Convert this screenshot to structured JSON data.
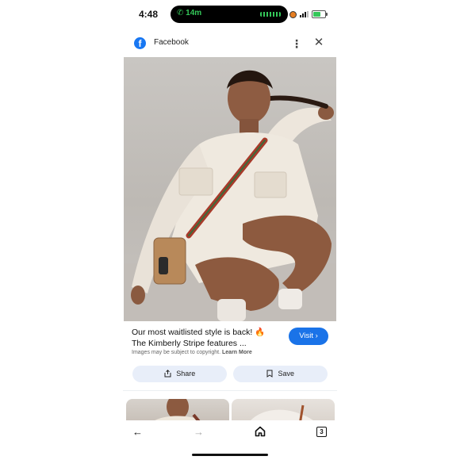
{
  "status_bar": {
    "time": "4:48",
    "call_duration": "14m"
  },
  "header": {
    "app_name": "Facebook",
    "logo_letter": "f",
    "more_glyph": "⋮",
    "close_glyph": "✕"
  },
  "post": {
    "caption_line1": "Our most waitlisted style is back! 🔥",
    "caption_line2": "The Kimberly Stripe features ...",
    "copyright_note": "Images may be subject to copyright.",
    "learn_more": "Learn More",
    "visit_label": "Visit ›"
  },
  "actions": {
    "share_label": "Share",
    "save_label": "Save"
  },
  "bottom_nav": {
    "back_glyph": "←",
    "forward_glyph": "→",
    "tab_count": "3"
  },
  "icons": {
    "logo": "facebook-logo-icon",
    "more": "more-vertical-icon",
    "close": "close-icon",
    "share": "share-icon",
    "save": "bookmark-icon",
    "back": "arrow-left-icon",
    "forward": "arrow-right-icon",
    "home": "home-icon",
    "tabs": "tabs-icon"
  },
  "colors": {
    "accent": "#1a73e8",
    "facebook_blue": "#1877f2",
    "call_green": "#34c759",
    "chip_background": "#e8eef9"
  }
}
